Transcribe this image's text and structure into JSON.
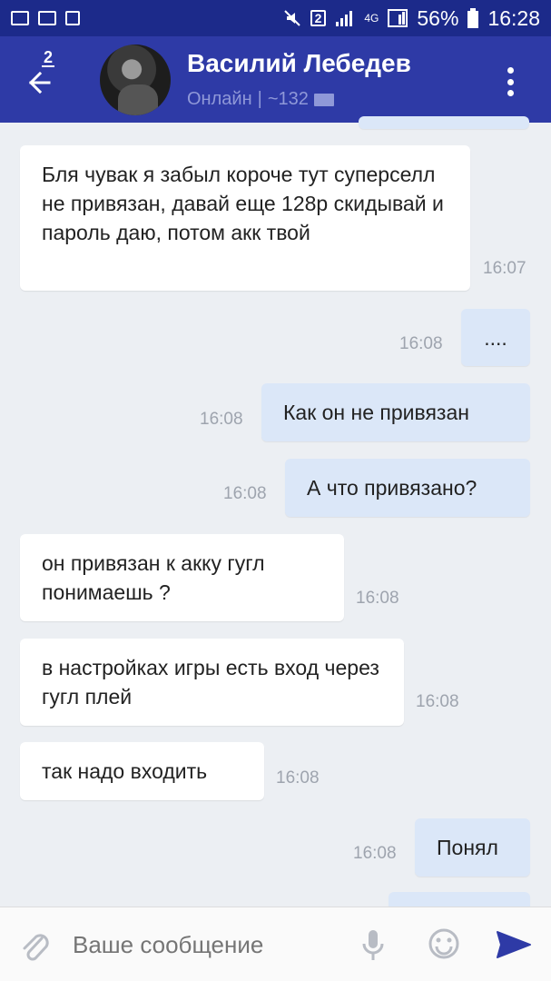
{
  "status_bar": {
    "battery": "56%",
    "time": "16:28",
    "sim": "2",
    "net": "4G"
  },
  "header": {
    "title": "Василий Лебедев",
    "status": "Онлайн",
    "divider": "|",
    "count": "~132",
    "back_badge": "2"
  },
  "messages": [
    {
      "dir": "in",
      "text": "Бля чувак я забыл короче тут суперселл не привязан, давай еще 128р скидывай и пароль даю, потом акк твой",
      "time": "16:07"
    },
    {
      "dir": "out",
      "text": "....",
      "time": "16:08"
    },
    {
      "dir": "out",
      "text": "Как он не привязан",
      "time": "16:08"
    },
    {
      "dir": "out",
      "text": "А что привязано?",
      "time": "16:08"
    },
    {
      "dir": "in",
      "text": "он привязан к акку гугл понимаешь ?",
      "time": "16:08"
    },
    {
      "dir": "in",
      "text": "в настройках игры есть вход через гугл плей",
      "time": "16:08"
    },
    {
      "dir": "in",
      "text": "так надо входить",
      "time": "16:08"
    },
    {
      "dir": "out",
      "text": "Понял",
      "time": "16:08"
    }
  ],
  "composer": {
    "placeholder": "Ваше сообщение"
  },
  "colors": {
    "status_bar": "#1c2a8a",
    "header": "#2e3aa6",
    "incoming": "#ffffff",
    "outgoing": "#dbe7f8",
    "background": "#eceff3",
    "send": "#2e3aa6"
  },
  "icons": [
    "image-icon",
    "gmail-icon",
    "screenshot-icon",
    "mute-icon",
    "signal-icon",
    "battery-icon",
    "back-arrow-icon",
    "more-vert-icon",
    "attach-icon",
    "mic-icon",
    "emoji-icon",
    "send-icon",
    "mail-icon"
  ]
}
